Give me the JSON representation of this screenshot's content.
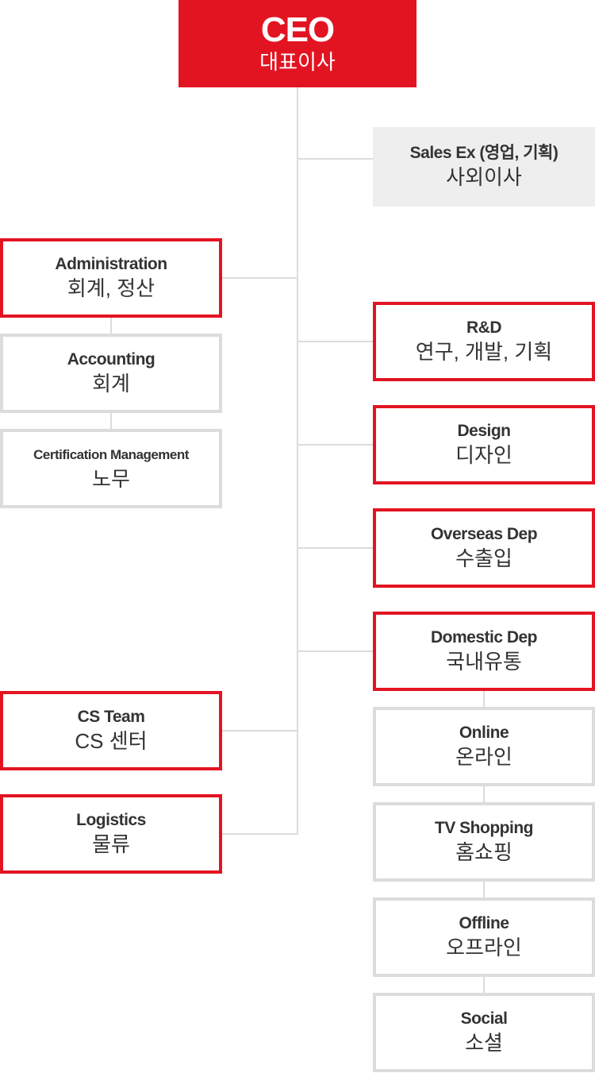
{
  "colors": {
    "accent": "#e31422",
    "gray_border": "#dcdcdc",
    "fill": "#eeeeee",
    "text": "#333333"
  },
  "ceo": {
    "en": "CEO",
    "ko": "대표이사"
  },
  "advisor": {
    "en": "Sales Ex (영업, 기획)",
    "ko": "사외이사"
  },
  "left": [
    {
      "en": "Administration",
      "ko": "회계, 정산",
      "style": "red"
    },
    {
      "en": "Accounting",
      "ko": "회계",
      "style": "gray"
    },
    {
      "en": "Certification Management",
      "ko": "노무",
      "style": "gray"
    },
    {
      "en": "CS Team",
      "ko": "CS 센터",
      "style": "red"
    },
    {
      "en": "Logistics",
      "ko": "물류",
      "style": "red"
    }
  ],
  "right": [
    {
      "en": "R&D",
      "ko": "연구, 개발, 기획",
      "style": "red"
    },
    {
      "en": "Design",
      "ko": "디자인",
      "style": "red"
    },
    {
      "en": "Overseas Dep",
      "ko": "수출입",
      "style": "red"
    },
    {
      "en": "Domestic Dep",
      "ko": "국내유통",
      "style": "red"
    },
    {
      "en": "Online",
      "ko": "온라인",
      "style": "gray"
    },
    {
      "en": "TV Shopping",
      "ko": "홈쇼핑",
      "style": "gray"
    },
    {
      "en": "Offline",
      "ko": "오프라인",
      "style": "gray"
    },
    {
      "en": "Social",
      "ko": "소셜",
      "style": "gray"
    }
  ]
}
